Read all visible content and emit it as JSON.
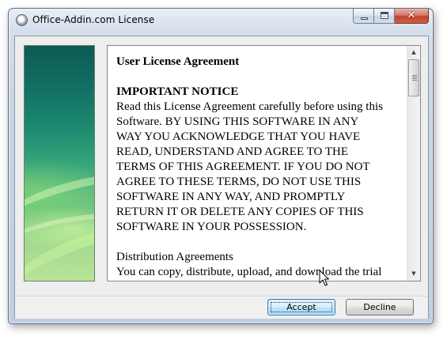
{
  "window": {
    "title": "Office-Addin.com License",
    "close_glyph": "✕"
  },
  "license": {
    "heading": "User License Agreement",
    "notice_title": "IMPORTANT NOTICE",
    "body_lines": [
      "Read this License Agreement carefully before using this",
      "Software. BY USING THIS SOFTWARE IN ANY",
      "WAY YOU ACKNOWLEDGE THAT YOU HAVE",
      "READ, UNDERSTAND AND AGREE TO THE",
      "TERMS OF THIS AGREEMENT. IF YOU DO NOT",
      "AGREE TO THESE TERMS, DO NOT USE THIS",
      "SOFTWARE IN ANY WAY, AND PROMPTLY",
      "RETURN IT OR DELETE ANY COPIES OF THIS",
      "SOFTWARE IN YOUR POSSESSION."
    ],
    "distribution_title": "Distribution Agreements",
    "distribution_line": "You can copy, distribute, upload, and download the trial"
  },
  "scrollbar": {
    "up_arrow": "▲",
    "down_arrow": "▼"
  },
  "buttons": {
    "accept_label": "Accept",
    "decline_label": "Decline"
  },
  "icons": {
    "app": "app-icon",
    "minimize": "minimize-icon",
    "maximize": "maximize-icon",
    "close": "close-icon",
    "cursor": "mouse-pointer-icon"
  }
}
